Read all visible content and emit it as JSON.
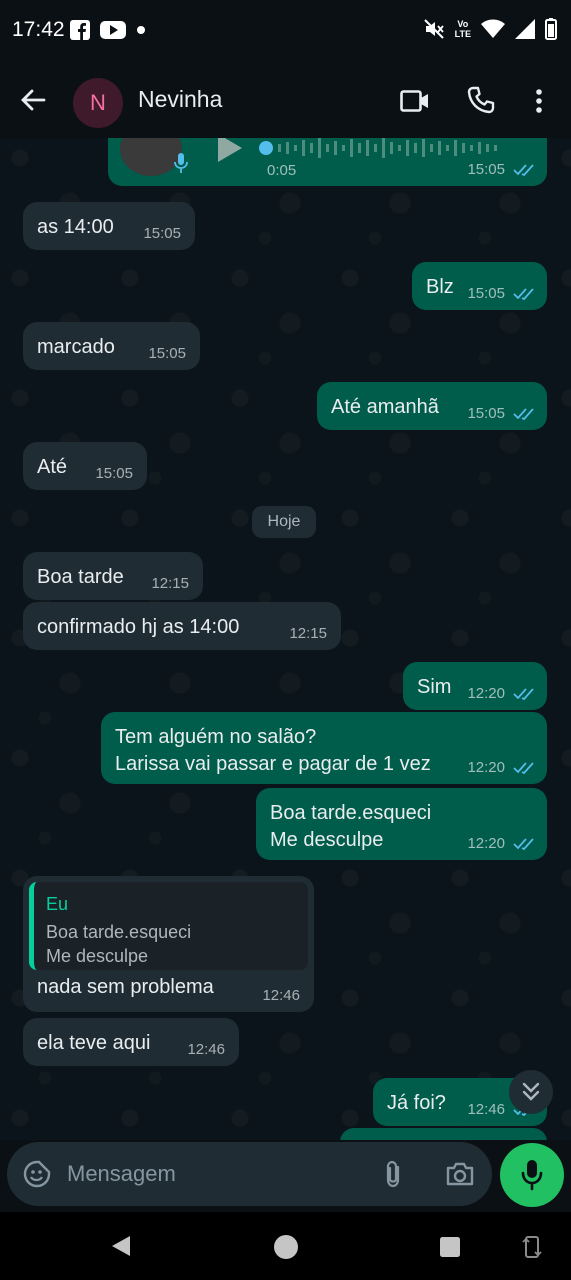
{
  "status_bar": {
    "time": "17:42",
    "left_icons": [
      "facebook-icon",
      "youtube-icon",
      "notification-dot-icon"
    ],
    "right_icons": [
      "mute-icon",
      "volte-icon",
      "wifi-icon",
      "signal-icon",
      "battery-icon"
    ],
    "volte_line1": "Vo",
    "volte_line2": "LTE"
  },
  "app_bar": {
    "avatar_letter": "N",
    "contact_name": "Nevinha",
    "actions": [
      "video-call-icon",
      "voice-call-icon",
      "more-options-icon"
    ]
  },
  "chat": {
    "voice_message": {
      "duration": "0:05",
      "time": "15:05",
      "status": "read"
    },
    "date_chip": "Hoje",
    "messages": [
      {
        "dir": "in",
        "text": "as 14:00",
        "time": "15:05"
      },
      {
        "dir": "out",
        "text": "Blz",
        "time": "15:05",
        "status": "read"
      },
      {
        "dir": "in",
        "text": "marcado",
        "time": "15:05"
      },
      {
        "dir": "out",
        "text": "Até amanhã",
        "time": "15:05",
        "status": "read"
      },
      {
        "dir": "in",
        "text": "Até",
        "time": "15:05"
      },
      {
        "dir": "in",
        "text": "Boa tarde",
        "time": "12:15"
      },
      {
        "dir": "in",
        "text": "confirmado hj as 14:00",
        "time": "12:15"
      },
      {
        "dir": "out",
        "text": "Sim",
        "time": "12:20",
        "status": "read"
      },
      {
        "dir": "out",
        "text": "Tem alguém no salão?\nLarissa vai passar e pagar de 1 vez",
        "time": "12:20",
        "status": "read"
      },
      {
        "dir": "out",
        "text": "Boa tarde.esqueci\nMe desculpe",
        "time": "12:20",
        "status": "read"
      },
      {
        "dir": "in",
        "text": "nada sem problema",
        "time": "12:46",
        "quote": {
          "author": "Eu",
          "text": "Boa tarde.esqueci\nMe desculpe"
        }
      },
      {
        "dir": "in",
        "text": "ela teve aqui",
        "time": "12:46"
      },
      {
        "dir": "out",
        "text": "Já foi?",
        "time": "12:46",
        "status": "read"
      }
    ]
  },
  "composer": {
    "placeholder": "Mensagem",
    "icons": [
      "emoji-sticker-icon",
      "attach-icon",
      "camera-icon",
      "microphone-icon"
    ]
  },
  "nav_bar": {
    "icons": [
      "back-nav-icon",
      "home-nav-icon",
      "recents-nav-icon",
      "rotate-icon"
    ]
  },
  "colors": {
    "background": "#0b141a",
    "incoming_bubble": "#1f2c34",
    "outgoing_bubble": "#005c4b",
    "accent_green": "#21c063",
    "read_ticks": "#53bdeb",
    "avatar_text": "#f56fa0"
  }
}
